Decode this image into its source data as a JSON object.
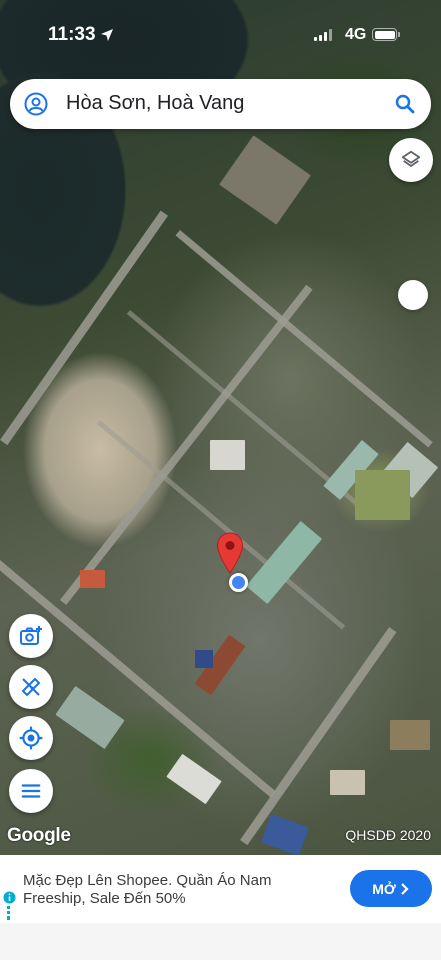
{
  "status_bar": {
    "time": "11:33",
    "network": "4G"
  },
  "search": {
    "query": "Hòa Sơn, Hoà Vang"
  },
  "map": {
    "logo": "Google",
    "attribution": "QHSDĐ 2020",
    "pin_color": "#e53935",
    "location_color": "#4285f4"
  },
  "controls": {
    "layers": "layers-icon",
    "camera": "camera-plus-icon",
    "measure": "ruler-pencil-icon",
    "my_location": "my-location-icon",
    "menu": "menu-icon"
  },
  "ad": {
    "text": "Mặc Đẹp Lên Shopee. Quần Áo Nam Freeship, Sale Đến 50%",
    "button_label": "MỞ"
  }
}
